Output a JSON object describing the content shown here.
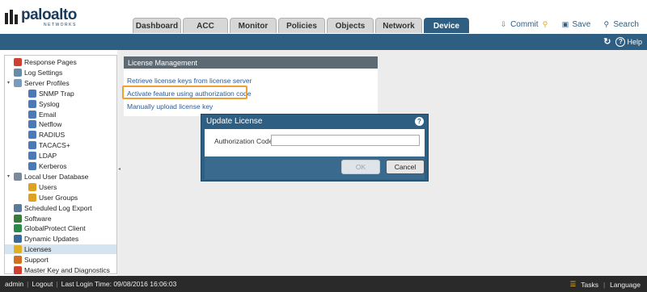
{
  "logo": {
    "name": "paloalto",
    "sub": "NETWORKS"
  },
  "tabs": [
    "Dashboard",
    "ACC",
    "Monitor",
    "Policies",
    "Objects",
    "Network",
    "Device"
  ],
  "active_tab": "Device",
  "actions": {
    "commit": "Commit",
    "save": "Save",
    "search": "Search"
  },
  "toolbar": {
    "refresh_icon": "refresh-icon",
    "help": "Help"
  },
  "sidebar": {
    "items": [
      {
        "label": "Response Pages",
        "icon": "page-icon",
        "color": "#d04030"
      },
      {
        "label": "Log Settings",
        "icon": "log-icon",
        "color": "#6a8aaa"
      },
      {
        "label": "Server Profiles",
        "icon": "server-profiles-icon",
        "color": "#7a9abe"
      },
      {
        "label": "SNMP Trap",
        "icon": "profile-icon",
        "color": "#4a7ab8"
      },
      {
        "label": "Syslog",
        "icon": "profile-icon",
        "color": "#4a7ab8"
      },
      {
        "label": "Email",
        "icon": "profile-icon",
        "color": "#4a7ab8"
      },
      {
        "label": "Netflow",
        "icon": "profile-icon",
        "color": "#4a7ab8"
      },
      {
        "label": "RADIUS",
        "icon": "profile-icon",
        "color": "#4a7ab8"
      },
      {
        "label": "TACACS+",
        "icon": "profile-icon",
        "color": "#4a7ab8"
      },
      {
        "label": "LDAP",
        "icon": "profile-icon",
        "color": "#4a7ab8"
      },
      {
        "label": "Kerberos",
        "icon": "profile-icon",
        "color": "#4a7ab8"
      },
      {
        "label": "Local User Database",
        "icon": "database-icon",
        "color": "#7a8a9a"
      },
      {
        "label": "Users",
        "icon": "user-icon",
        "color": "#e0a020"
      },
      {
        "label": "User Groups",
        "icon": "users-icon",
        "color": "#e0a020"
      },
      {
        "label": "Scheduled Log Export",
        "icon": "export-icon",
        "color": "#5a7a9a"
      },
      {
        "label": "Software",
        "icon": "software-icon",
        "color": "#3a7a3a"
      },
      {
        "label": "GlobalProtect Client",
        "icon": "globe-icon",
        "color": "#2a8a4a"
      },
      {
        "label": "Dynamic Updates",
        "icon": "update-icon",
        "color": "#3a6a9a"
      },
      {
        "label": "Licenses",
        "icon": "key-icon",
        "color": "#e0b020"
      },
      {
        "label": "Support",
        "icon": "support-icon",
        "color": "#d07020"
      },
      {
        "label": "Master Key and Diagnostics",
        "icon": "master-key-icon",
        "color": "#d04030"
      }
    ],
    "selected": "Licenses"
  },
  "panel": {
    "title": "License Management",
    "links": [
      "Retrieve license keys from license server",
      "Activate feature using authorization code",
      "Manually upload license key"
    ]
  },
  "dialog": {
    "title": "Update License",
    "field_label": "Authorization Code",
    "field_value": "",
    "ok": "OK",
    "cancel": "Cancel"
  },
  "footer": {
    "user": "admin",
    "logout": "Logout",
    "last_login": "Last Login Time: 09/08/2016 16:06:03",
    "tasks": "Tasks",
    "language": "Language"
  }
}
